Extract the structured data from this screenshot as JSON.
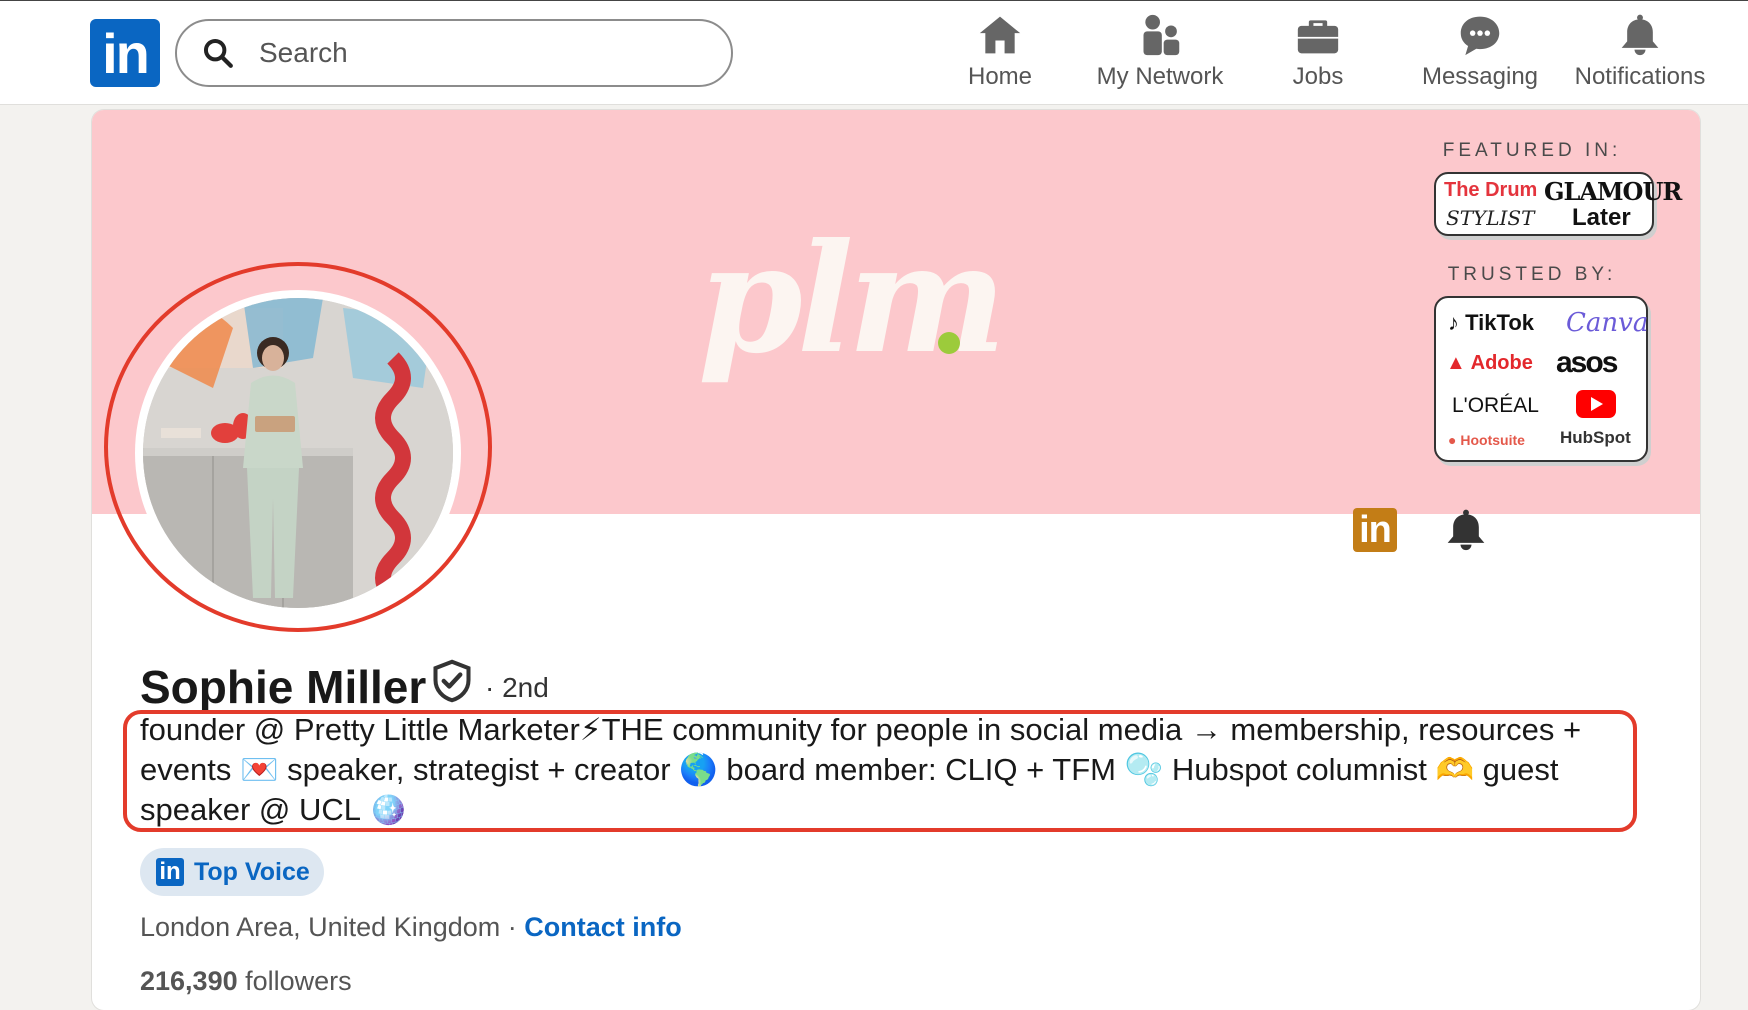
{
  "nav": {
    "logo_text": "in",
    "search_placeholder": "Search",
    "items": [
      {
        "label": "Home",
        "icon": "home-icon"
      },
      {
        "label": "My Network",
        "icon": "network-icon"
      },
      {
        "label": "Jobs",
        "icon": "briefcase-icon"
      },
      {
        "label": "Messaging",
        "icon": "messaging-icon"
      },
      {
        "label": "Notifications",
        "icon": "bell-icon"
      }
    ]
  },
  "banner": {
    "brand_text": "plm",
    "featured_label": "FEATURED IN:",
    "featured": [
      "The Drum",
      "GLAMOUR",
      "STYLIST",
      "Later"
    ],
    "trusted_label": "TRUSTED BY:",
    "trusted": [
      "TikTok",
      "Canva",
      "Adobe",
      "asos",
      "L'ORÉAL",
      "Hootsuite",
      "HubSpot"
    ],
    "bg_color": "#fcc8cc"
  },
  "profile": {
    "name": "Sophie Miller",
    "degree": "· 2nd",
    "headline": "founder @ Pretty Little Marketer⚡THE community for people in social media → membership, resources + events 💌 speaker, strategist + creator 🌎 board member: CLIQ + TFM 🫧 Hubspot columnist 🫶 guest speaker @ UCL 🪩",
    "badge_label": "Top Voice",
    "badge_logo": "in",
    "location": "London Area, United Kingdom",
    "separator": " · ",
    "contact_label": "Contact info",
    "followers_count": "216,390",
    "followers_label": " followers",
    "highlight_color": "#e33b2b"
  },
  "actions": {
    "linkedin_button": "in"
  }
}
